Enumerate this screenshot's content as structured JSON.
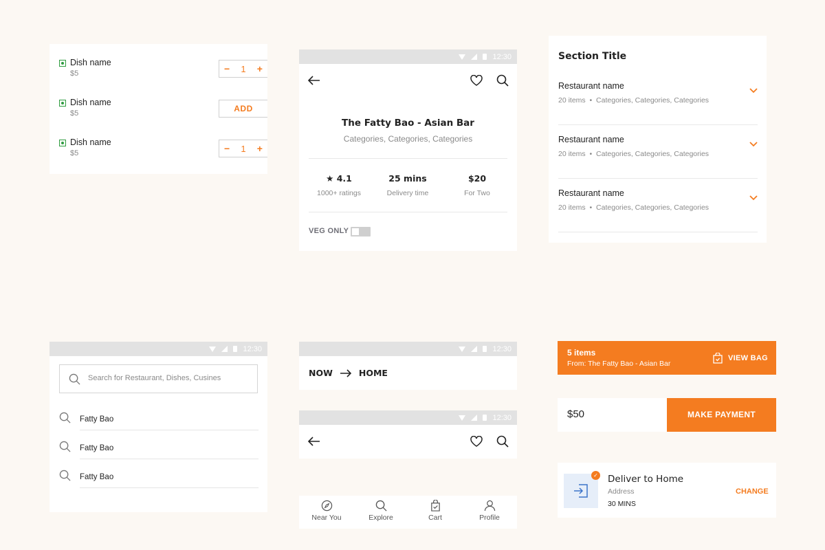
{
  "menu_card": {
    "items": [
      {
        "name": "Dish name",
        "price": "$5",
        "control": "stepper",
        "quantity": "1"
      },
      {
        "name": "Dish name",
        "price": "$5",
        "control": "add",
        "add_label": "ADD"
      },
      {
        "name": "Dish name",
        "price": "$5",
        "control": "stepper",
        "quantity": "1"
      }
    ],
    "minus": "−",
    "plus": "+"
  },
  "status_bar": {
    "time": "12:30"
  },
  "restaurant_card": {
    "name": "The Fatty Bao - Asian Bar",
    "categories": "Categories, Categories, Categories",
    "stats": [
      {
        "value": "★ 4.1",
        "label": "1000+ ratings"
      },
      {
        "value": "25 mins",
        "label": "Delivery time"
      },
      {
        "value": "$20",
        "label": "For Two"
      }
    ],
    "veg_only_label": "VEG ONLY",
    "veg_only_on": false
  },
  "section_card": {
    "title": "Section Title",
    "restaurants": [
      {
        "name": "Restaurant name",
        "count": "20 items",
        "categories": "Categories, Categories, Categories"
      },
      {
        "name": "Restaurant name",
        "count": "20 items",
        "categories": "Categories, Categories, Categories"
      },
      {
        "name": "Restaurant name",
        "count": "20 items",
        "categories": "Categories, Categories, Categories"
      }
    ]
  },
  "search_card": {
    "placeholder": "Search for Restaurant, Dishes, Cusines",
    "suggestions": [
      "Fatty Bao",
      "Fatty Bao",
      "Fatty Bao"
    ]
  },
  "delivery_header": {
    "from": "NOW",
    "to": "HOME"
  },
  "bottom_nav": {
    "items": [
      {
        "label": "Near You",
        "icon": "compass-icon"
      },
      {
        "label": "Explore",
        "icon": "search-icon"
      },
      {
        "label": "Cart",
        "icon": "bag-icon"
      },
      {
        "label": "Profile",
        "icon": "user-icon"
      }
    ]
  },
  "bag_bar": {
    "items": "5 items",
    "from": "From: The Fatty Bao - Asian Bar",
    "cta": "VIEW BAG"
  },
  "payment_bar": {
    "amount": "$50",
    "cta": "MAKE PAYMENT"
  },
  "address_card": {
    "title": "Deliver to Home",
    "subtitle": "Address",
    "eta": "30 MINS",
    "change": "CHANGE"
  },
  "colors": {
    "accent": "#f47c20",
    "veg": "#2e9b3f",
    "background": "#fcf8f3"
  }
}
